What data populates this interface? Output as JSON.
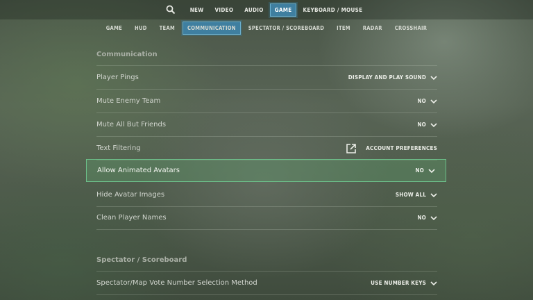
{
  "topnav": {
    "tabs": [
      "NEW",
      "VIDEO",
      "AUDIO",
      "GAME",
      "KEYBOARD / MOUSE"
    ],
    "active": "GAME"
  },
  "subnav": {
    "tabs": [
      "GAME",
      "HUD",
      "TEAM",
      "COMMUNICATION",
      "SPECTATOR / SCOREBOARD",
      "ITEM",
      "RADAR",
      "CROSSHAIR"
    ],
    "active": "COMMUNICATION"
  },
  "communication": {
    "title": "Communication",
    "rows": [
      {
        "label": "Player Pings",
        "value": "DISPLAY AND PLAY SOUND"
      },
      {
        "label": "Mute Enemy Team",
        "value": "NO"
      },
      {
        "label": "Mute All But Friends",
        "value": "NO"
      },
      {
        "label": "Text Filtering",
        "value": "ACCOUNT PREFERENCES"
      },
      {
        "label": "Allow Animated Avatars",
        "value": "NO"
      },
      {
        "label": "Hide Avatar Images",
        "value": "SHOW ALL"
      },
      {
        "label": "Clean Player Names",
        "value": "NO"
      }
    ]
  },
  "spectator": {
    "title": "Spectator / Scoreboard",
    "rows": [
      {
        "label": "Spectator/Map Vote Number Selection Method",
        "value": "USE NUMBER KEYS"
      }
    ]
  },
  "colors": {
    "accent_blue": "#3f7fa0",
    "highlight_green": "#6cc08a"
  },
  "icons": {
    "search": "search-icon",
    "dropdown": "chevron-down-icon",
    "external": "external-link-icon"
  }
}
